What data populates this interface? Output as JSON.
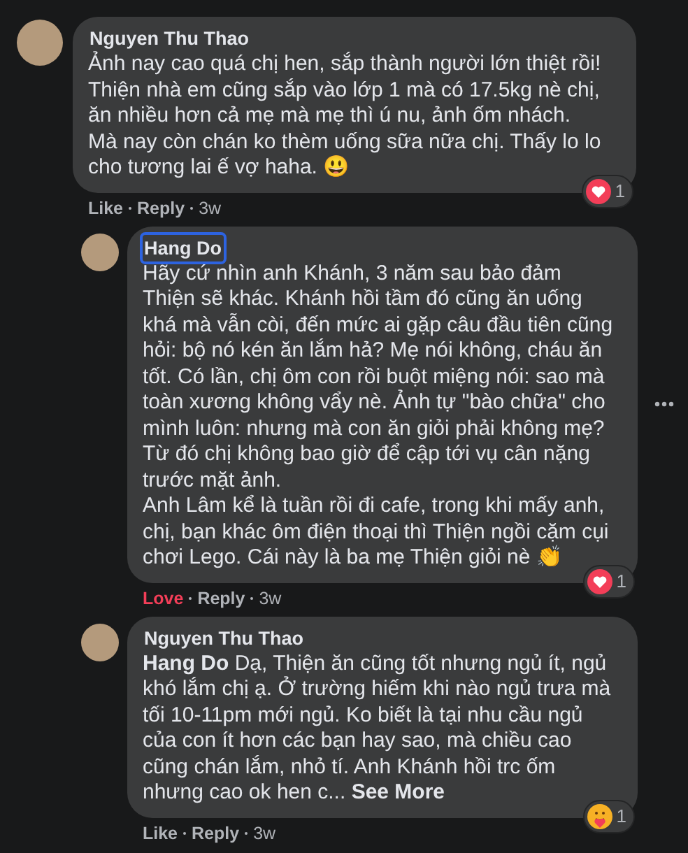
{
  "comments": [
    {
      "author": "Nguyen Thu Thao",
      "author_focused": false,
      "is_reply": false,
      "text": "Ảnh nay cao quá chị hen, sắp thành người lớn thiệt rồi! Thiện nhà em cũng sắp vào lớp 1 mà có 17.5kg nè chị, ăn nhiều hơn cả mẹ mà mẹ thì ú nu, ảnh ốm nhách. Mà nay còn chán ko thèm uống sữa nữa chị. Thấy lo lo cho tương lai ế vợ haha. 😃",
      "reactions": {
        "kind": "love",
        "count": "1"
      },
      "action": {
        "label": "Like",
        "reacted": false
      },
      "reply": "Reply",
      "time": "3w",
      "more_menu": false
    },
    {
      "author": "Hang Do",
      "author_focused": true,
      "is_reply": true,
      "text": "Hãy cứ nhìn anh Khánh, 3 năm sau bảo đảm Thiện sẽ khác. Khánh hồi tầm đó cũng ăn uống khá mà vẫn còi, đến mức ai gặp câu đầu tiên cũng hỏi: bộ nó kén ăn lắm hả? Mẹ nói không, cháu ăn tốt. Có lần, chị ôm con rồi buột miệng nói: sao mà toàn xương không vẩy nè. Ảnh tự \"bào chữa\" cho mình luôn: nhưng mà con ăn giỏi phải không mẹ? Từ đó chị không bao giờ để cập tới vụ cân nặng trước mặt ảnh.\nAnh Lâm kể là tuần rồi đi cafe, trong khi mấy anh, chị, bạn khác ôm điện thoại thì Thiện ngồi cặm cụi chơi Lego. Cái này là ba mẹ Thiện giỏi nè 👏",
      "reactions": {
        "kind": "love",
        "count": "1"
      },
      "action": {
        "label": "Love",
        "reacted": true
      },
      "reply": "Reply",
      "time": "3w",
      "more_menu": true
    },
    {
      "author": "Nguyen Thu Thao",
      "author_focused": false,
      "is_reply": true,
      "text": "**Hang Do** Dạ, Thiện ăn cũng tốt nhưng ngủ ít, ngủ khó lắm chị ạ. Ở trường hiếm khi nào ngủ trưa mà tối 10-11pm mới ngủ. Ko biết là tại nhu cầu ngủ của con ít hơn các bạn hay sao, mà chiều cao cũng chán lắm, nhỏ tí. Anh Khánh hồi trc ốm nhưng cao ok hen c...",
      "see_more": "See More",
      "reactions": {
        "kind": "care",
        "count": "1"
      },
      "action": {
        "label": "Like",
        "reacted": false
      },
      "reply": "Reply",
      "time": "3w",
      "more_menu": false
    }
  ]
}
